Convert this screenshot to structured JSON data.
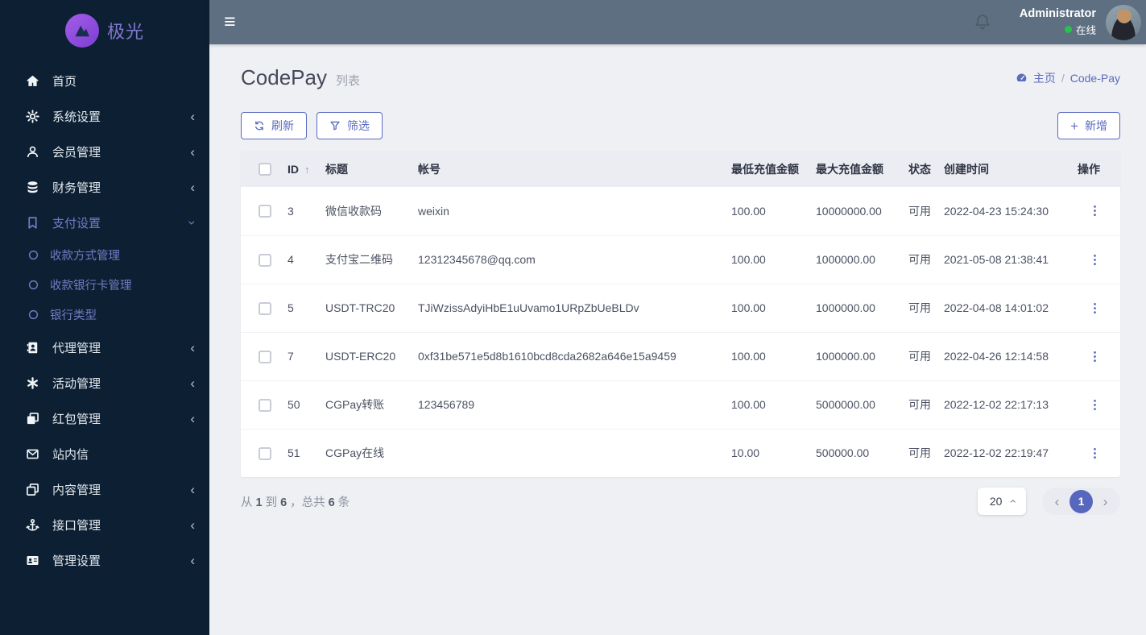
{
  "colors": {
    "accent": "#5c6bc0",
    "sidebar_bg": "#0d2033",
    "topbar_bg": "#5d6f80",
    "online_green": "#27c24c",
    "active_page": "#5867be"
  },
  "sidebar": {
    "logo_text": "极光",
    "items": [
      {
        "name": "home",
        "icon": "home-icon",
        "label": "首页",
        "expandable": false
      },
      {
        "name": "system-settings",
        "icon": "gear-icon",
        "label": "系统设置",
        "expandable": true
      },
      {
        "name": "member-management",
        "icon": "user-icon",
        "label": "会员管理",
        "expandable": true
      },
      {
        "name": "finance-management",
        "icon": "database-icon",
        "label": "财务管理",
        "expandable": true
      },
      {
        "name": "payment-settings",
        "icon": "bookmark-icon",
        "label": "支付设置",
        "expandable": true,
        "active": true,
        "expanded": true,
        "children": [
          {
            "name": "payment-method-management",
            "label": "收款方式管理"
          },
          {
            "name": "receiving-bank-card-management",
            "label": "收款银行卡管理"
          },
          {
            "name": "bank-type",
            "label": "银行类型"
          }
        ]
      },
      {
        "name": "agent-management",
        "icon": "address-book-icon",
        "label": "代理管理",
        "expandable": true
      },
      {
        "name": "activity-management",
        "icon": "asterisk-icon",
        "label": "活动管理",
        "expandable": true
      },
      {
        "name": "redpacket-management",
        "icon": "clone-filled-icon",
        "label": "红包管理",
        "expandable": true
      },
      {
        "name": "site-messages",
        "icon": "envelope-icon",
        "label": "站内信",
        "expandable": false
      },
      {
        "name": "content-management",
        "icon": "copy-icon",
        "label": "内容管理",
        "expandable": true
      },
      {
        "name": "api-management",
        "icon": "anchor-icon",
        "label": "接口管理",
        "expandable": true
      },
      {
        "name": "admin-settings",
        "icon": "id-card-icon",
        "label": "管理设置",
        "expandable": true
      }
    ]
  },
  "topbar": {
    "username": "Administrator",
    "status_label": "在线"
  },
  "page": {
    "title": "CodePay",
    "subtitle": "列表",
    "breadcrumb": {
      "home": "主页",
      "separator": "/",
      "current": "Code-Pay"
    }
  },
  "toolbar": {
    "refresh": "刷新",
    "filter": "筛选",
    "add": "新增"
  },
  "table": {
    "columns": [
      "ID",
      "标题",
      "帐号",
      "最低充值金额",
      "最大充值金额",
      "状态",
      "创建时间",
      "操作"
    ],
    "rows": [
      {
        "id": "3",
        "title": "微信收款码",
        "account": "weixin",
        "min": "100.00",
        "max": "10000000.00",
        "status": "可用",
        "created": "2022-04-23 15:24:30"
      },
      {
        "id": "4",
        "title": "支付宝二维码",
        "account": "12312345678@qq.com",
        "min": "100.00",
        "max": "1000000.00",
        "status": "可用",
        "created": "2021-05-08 21:38:41"
      },
      {
        "id": "5",
        "title": "USDT-TRC20",
        "account": "TJiWzissAdyiHbE1uUvamo1URpZbUeBLDv",
        "min": "100.00",
        "max": "1000000.00",
        "status": "可用",
        "created": "2022-04-08 14:01:02"
      },
      {
        "id": "7",
        "title": "USDT-ERC20",
        "account": "0xf31be571e5d8b1610bcd8cda2682a646e15a9459",
        "min": "100.00",
        "max": "1000000.00",
        "status": "可用",
        "created": "2022-04-26 12:14:58"
      },
      {
        "id": "50",
        "title": "CGPay转账",
        "account": "123456789",
        "min": "100.00",
        "max": "5000000.00",
        "status": "可用",
        "created": "2022-12-02 22:17:13"
      },
      {
        "id": "51",
        "title": "CGPay在线",
        "account": "",
        "min": "10.00",
        "max": "500000.00",
        "status": "可用",
        "created": "2022-12-02 22:19:47"
      }
    ]
  },
  "footer": {
    "info": {
      "p1": "从",
      "from": "1",
      "p2": "到",
      "to": "6",
      "p3": "，总共",
      "total": "6",
      "p4": "条"
    }
  },
  "pagination": {
    "page_size": "20",
    "current_page": "1"
  }
}
